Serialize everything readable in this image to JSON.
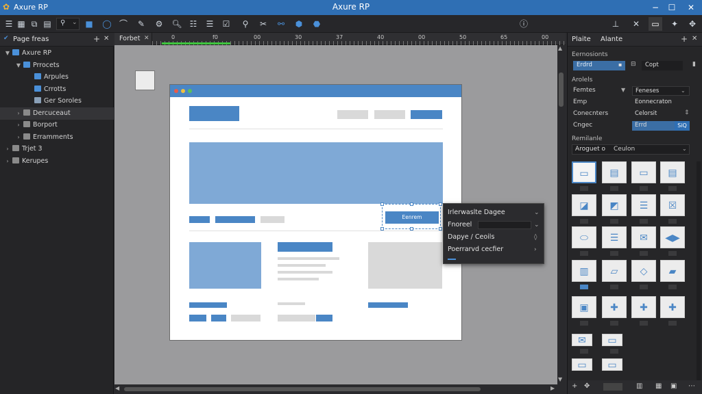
{
  "app": {
    "title": "Axure RP"
  },
  "left_panel": {
    "title": "Page freas",
    "tree": [
      {
        "label": "Axure RP",
        "depth": 0,
        "expanded": true,
        "color": "#4a90d9",
        "selected": false
      },
      {
        "label": "Prrocets",
        "depth": 1,
        "expanded": true,
        "color": "#4a90d9",
        "selected": false
      },
      {
        "label": "Arpules",
        "depth": 2,
        "color": "#4a90d9",
        "selected": false
      },
      {
        "label": "Crrotts",
        "depth": 2,
        "color": "#4a90d9",
        "selected": false
      },
      {
        "label": "Ger Soroles",
        "depth": 2,
        "color": "#8aa0b8",
        "selected": false
      },
      {
        "label": "Dercuceaut",
        "depth": 1,
        "color": "#8a8a8a",
        "selected": true
      },
      {
        "label": "Borport",
        "depth": 1,
        "color": "#8a8a8a",
        "selected": false
      },
      {
        "label": "Erramments",
        "depth": 1,
        "color": "#8a8a8a",
        "selected": false
      },
      {
        "label": "Trjet 3",
        "depth": 0,
        "color": "#8a8a8a",
        "selected": false
      },
      {
        "label": "Kerupes",
        "depth": 0,
        "color": "#8a8a8a",
        "selected": false
      }
    ]
  },
  "canvas": {
    "tab_label": "Forbet",
    "ruler_labels": [
      "0",
      "f0",
      "00",
      "30",
      "37",
      "40",
      "00",
      "50",
      "65",
      "00"
    ],
    "wireframe": {
      "selected_button_label": "Eenrem"
    }
  },
  "context_menu": {
    "items": [
      {
        "label": "Irlerwaslte Dagee",
        "suffix": "⌄"
      },
      {
        "label": "Fnoreel",
        "suffix": "⌄"
      },
      {
        "label": "Dapye / Ceoils",
        "suffix": "◊"
      },
      {
        "label": "Poerrarvd cecfier",
        "suffix": "›"
      }
    ]
  },
  "right_panel": {
    "tabs": [
      "Plaite",
      "Alante"
    ],
    "section1": "Eernosionts",
    "field_a": "Erdrd",
    "field_b": "Copt",
    "section2": "Arolels",
    "props": [
      {
        "label": "Femtes",
        "value": "Feneses"
      },
      {
        "label": "Emp",
        "value": "Eonnecraton"
      },
      {
        "label": "Conecnters",
        "value": "Celorsit"
      },
      {
        "label": "Cngec",
        "value": "Errd",
        "badge": "SiQ"
      }
    ],
    "section3": "Remilanle",
    "dropdown_label": "Aroguet o",
    "dropdown_value": "Ceulon"
  },
  "colors": {
    "accent": "#2f6fb4",
    "wire_blue": "#4a86c5",
    "wire_gray": "#d9d9d9"
  }
}
